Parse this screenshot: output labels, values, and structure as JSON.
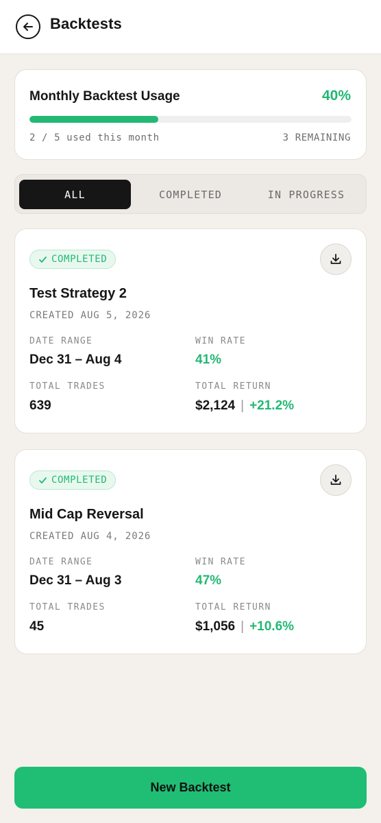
{
  "header": {
    "title": "Backtests",
    "back_icon": "arrow-left-icon"
  },
  "usage": {
    "title": "Monthly Backtest Usage",
    "percent_label": "40%",
    "percent": 40,
    "used_text": "2 / 5 used this month",
    "remaining_text": "3 REMAINING",
    "accent_color": "#23b874"
  },
  "tabs": [
    {
      "label": "ALL",
      "active": true
    },
    {
      "label": "COMPLETED",
      "active": false
    },
    {
      "label": "IN PROGRESS",
      "active": false
    }
  ],
  "backtests": [
    {
      "status": "COMPLETED",
      "name": "Test Strategy 2",
      "created": "CREATED AUG 5, 2026",
      "date_range_label": "DATE RANGE",
      "date_range": "Dec 31 – Aug 4",
      "win_rate_label": "WIN RATE",
      "win_rate": "41%",
      "total_trades_label": "TOTAL TRADES",
      "total_trades": "639",
      "total_return_label": "TOTAL RETURN",
      "total_return_amount": "$2,124",
      "total_return_sep": "|",
      "total_return_pct": "+21.2%"
    },
    {
      "status": "COMPLETED",
      "name": "Mid Cap Reversal",
      "created": "CREATED AUG 4, 2026",
      "date_range_label": "DATE RANGE",
      "date_range": "Dec 31 – Aug 3",
      "win_rate_label": "WIN RATE",
      "win_rate": "47%",
      "total_trades_label": "TOTAL TRADES",
      "total_trades": "45",
      "total_return_label": "TOTAL RETURN",
      "total_return_amount": "$1,056",
      "total_return_sep": "|",
      "total_return_pct": "+10.6%"
    }
  ],
  "new_button": {
    "label": "New Backtest",
    "color": "#20bd74"
  }
}
